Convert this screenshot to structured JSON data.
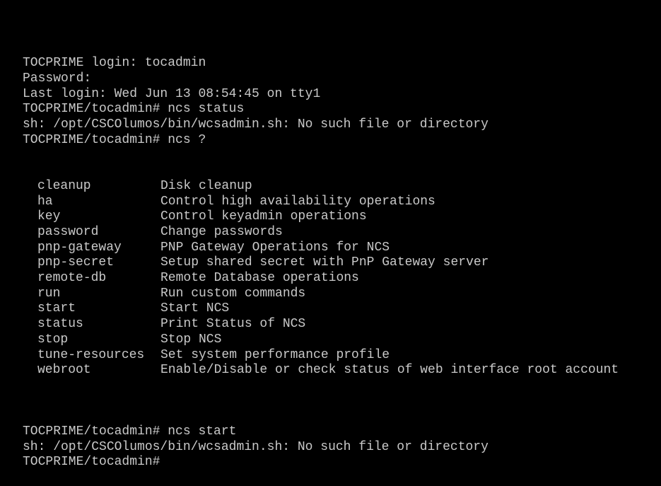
{
  "colors": {
    "background": "#000000",
    "text": "#c9c9c9"
  },
  "session": {
    "lines_before": [
      "TOCPRIME login: tocadmin",
      "Password:",
      "Last login: Wed Jun 13 08:54:45 on tty1",
      "TOCPRIME/tocadmin# ncs status",
      "sh: /opt/CSCOlumos/bin/wcsadmin.sh: No such file or directory",
      "TOCPRIME/tocadmin# ncs ?"
    ],
    "commands": [
      {
        "name": "cleanup",
        "desc": "Disk cleanup"
      },
      {
        "name": "ha",
        "desc": "Control high availability operations"
      },
      {
        "name": "key",
        "desc": "Control keyadmin operations"
      },
      {
        "name": "password",
        "desc": "Change passwords"
      },
      {
        "name": "pnp-gateway",
        "desc": "PNP Gateway Operations for NCS"
      },
      {
        "name": "pnp-secret",
        "desc": "Setup shared secret with PnP Gateway server"
      },
      {
        "name": "remote-db",
        "desc": "Remote Database operations"
      },
      {
        "name": "run",
        "desc": "Run custom commands"
      },
      {
        "name": "start",
        "desc": "Start NCS"
      },
      {
        "name": "status",
        "desc": "Print Status of NCS"
      },
      {
        "name": "stop",
        "desc": "Stop NCS"
      },
      {
        "name": "tune-resources",
        "desc": "Set system performance profile"
      },
      {
        "name": "webroot",
        "desc": "Enable/Disable or check status of web interface root account"
      }
    ],
    "lines_after": [
      "",
      "TOCPRIME/tocadmin# ncs start",
      "sh: /opt/CSCOlumos/bin/wcsadmin.sh: No such file or directory",
      "TOCPRIME/tocadmin#"
    ]
  }
}
